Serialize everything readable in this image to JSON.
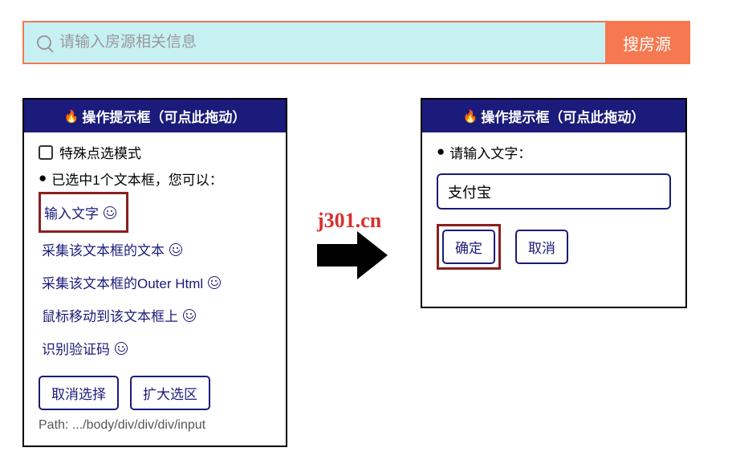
{
  "search": {
    "placeholder": "请输入房源相关信息",
    "button_label": "搜房源"
  },
  "panel_left": {
    "title": "操作提示框（可点此拖动）",
    "special_mode_label": "特殊点选模式",
    "selected_text": "已选中1个文本框，您可以：",
    "actions": {
      "input_text": "输入文字",
      "collect_text": "采集该文本框的文本",
      "collect_outer_html": "采集该文本框的Outer Html",
      "mouse_move": "鼠标移动到该文本框上",
      "recognize_captcha": "识别验证码"
    },
    "buttons": {
      "cancel_select": "取消选择",
      "expand_select": "扩大选区"
    },
    "path_label": "Path: .../body/div/div/div/input"
  },
  "panel_right": {
    "title": "操作提示框（可点此拖动）",
    "prompt": "请输入文字：",
    "input_value": "支付宝",
    "buttons": {
      "confirm": "确定",
      "cancel": "取消"
    }
  },
  "watermark": "j301.cn"
}
